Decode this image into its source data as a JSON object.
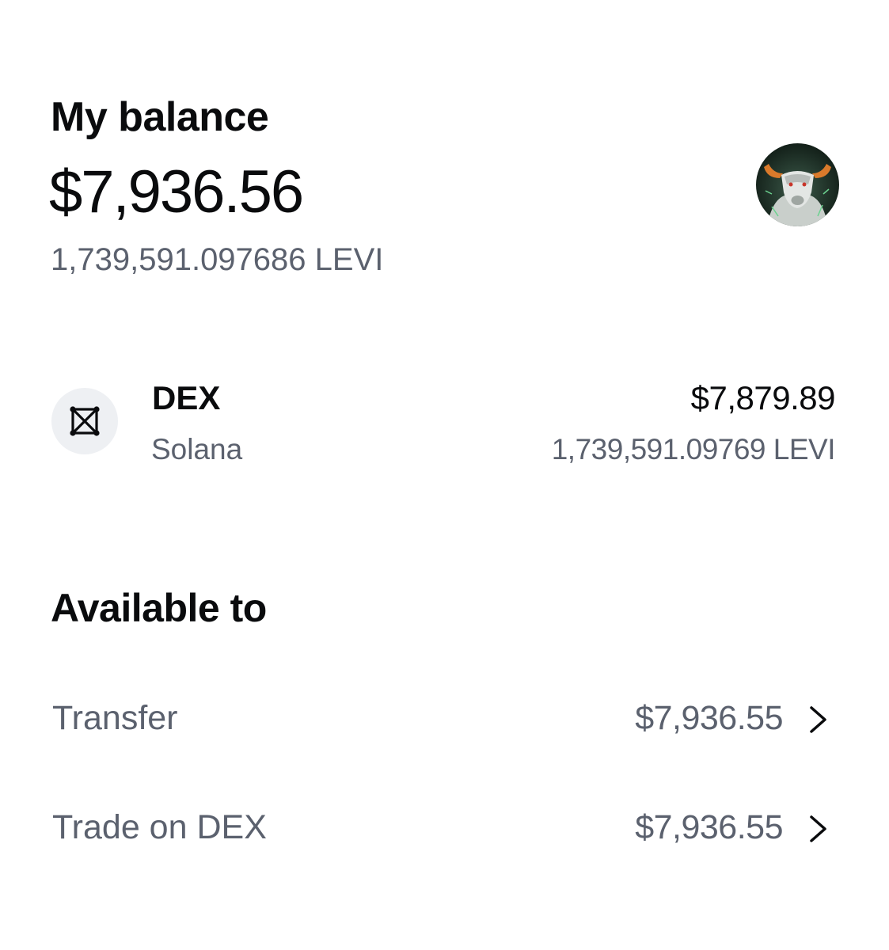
{
  "header": {
    "title": "My balance",
    "balance": "$7,936.56",
    "token_amount": "1,739,591.097686 LEVI",
    "avatar_icon": "bull-avatar-icon"
  },
  "asset": {
    "icon": "dex-icon",
    "name": "DEX",
    "network": "Solana",
    "fiat_value": "$7,879.89",
    "token_value": "1,739,591.09769 LEVI"
  },
  "available": {
    "title": "Available to",
    "rows": [
      {
        "label": "Transfer",
        "value": "$7,936.55"
      },
      {
        "label": "Trade on DEX",
        "value": "$7,936.55"
      }
    ]
  },
  "colors": {
    "primary_text": "#0a0b0d",
    "secondary_text": "#5b616e",
    "icon_bg": "#eef0f3"
  }
}
